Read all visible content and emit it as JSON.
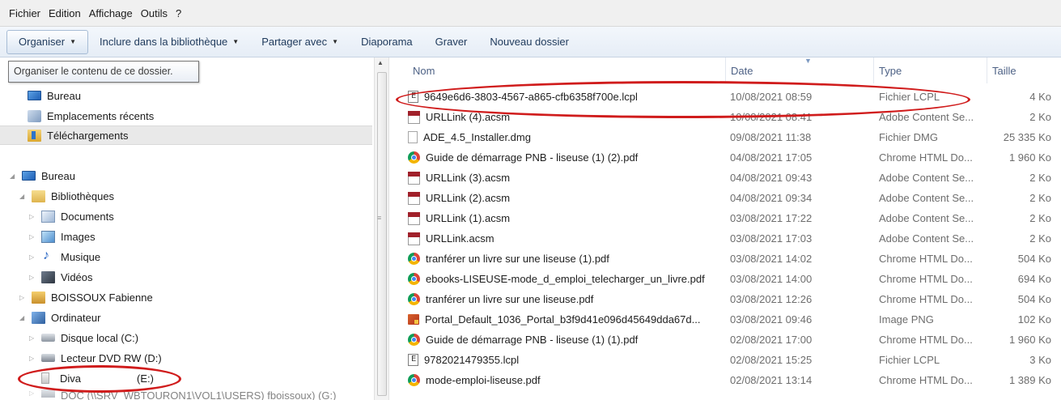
{
  "menu": [
    "Fichier",
    "Edition",
    "Affichage",
    "Outils",
    "?"
  ],
  "toolbar": {
    "organise_label": "Organiser",
    "include_label": "Inclure dans la bibliothèque",
    "share_label": "Partager avec",
    "slideshow_label": "Diaporama",
    "burn_label": "Graver",
    "new_folder_label": "Nouveau dossier"
  },
  "tooltip": "Organiser le contenu de ce dossier.",
  "nav": {
    "favorites": [
      {
        "label": "Bureau",
        "icon": "desktop-icon"
      },
      {
        "label": "Emplacements récents",
        "icon": "recent-places-icon"
      },
      {
        "label": "Téléchargements",
        "icon": "downloads-icon"
      }
    ],
    "tree": [
      {
        "label": "Bureau",
        "icon": "desktop-icon"
      },
      {
        "label": "Bibliothèques",
        "icon": "libraries-icon"
      },
      {
        "label": "Documents",
        "icon": "documents-icon"
      },
      {
        "label": "Images",
        "icon": "pictures-icon"
      },
      {
        "label": "Musique",
        "icon": "music-icon"
      },
      {
        "label": "Vidéos",
        "icon": "videos-icon"
      },
      {
        "label": "BOISSOUX Fabienne",
        "icon": "user-folder-icon"
      },
      {
        "label": "Ordinateur",
        "icon": "computer-icon"
      },
      {
        "label": "Disque local (C:)",
        "icon": "local-disk-icon"
      },
      {
        "label": "Lecteur DVD RW (D:)",
        "icon": "dvd-drive-icon"
      },
      {
        "label": "Diva",
        "drive": "(E:)",
        "icon": "usb-drive-icon"
      },
      {
        "label": "DOC (\\\\SRV_WBTOURON1\\VOL1\\USERS) fboissoux) (G:)",
        "icon": "network-drive-icon"
      }
    ]
  },
  "columns": {
    "name": "Nom",
    "date": "Date",
    "type": "Type",
    "size": "Taille"
  },
  "files": [
    {
      "name": "9649e6d6-3803-4567-a865-cfb6358f700e.lcpl",
      "date": "10/08/2021 08:59",
      "type": "Fichier LCPL",
      "size": "4 Ko",
      "icon": "lcpl"
    },
    {
      "name": "URLLink (4).acsm",
      "date": "10/08/2021 08:41",
      "type": "Adobe Content Se...",
      "size": "2 Ko",
      "icon": "acsm"
    },
    {
      "name": "ADE_4.5_Installer.dmg",
      "date": "09/08/2021 11:38",
      "type": "Fichier DMG",
      "size": "25 335 Ko",
      "icon": "dmg"
    },
    {
      "name": "Guide de démarrage PNB - liseuse (1) (2).pdf",
      "date": "04/08/2021 17:05",
      "type": "Chrome HTML Do...",
      "size": "1 960 Ko",
      "icon": "chrome"
    },
    {
      "name": "URLLink (3).acsm",
      "date": "04/08/2021 09:43",
      "type": "Adobe Content Se...",
      "size": "2 Ko",
      "icon": "acsm"
    },
    {
      "name": "URLLink (2).acsm",
      "date": "04/08/2021 09:34",
      "type": "Adobe Content Se...",
      "size": "2 Ko",
      "icon": "acsm"
    },
    {
      "name": "URLLink (1).acsm",
      "date": "03/08/2021 17:22",
      "type": "Adobe Content Se...",
      "size": "2 Ko",
      "icon": "acsm"
    },
    {
      "name": "URLLink.acsm",
      "date": "03/08/2021 17:03",
      "type": "Adobe Content Se...",
      "size": "2 Ko",
      "icon": "acsm"
    },
    {
      "name": "tranférer un livre sur une liseuse (1).pdf",
      "date": "03/08/2021 14:02",
      "type": "Chrome HTML Do...",
      "size": "504 Ko",
      "icon": "chrome"
    },
    {
      "name": "ebooks-LISEUSE-mode_d_emploi_telecharger_un_livre.pdf",
      "date": "03/08/2021 14:00",
      "type": "Chrome HTML Do...",
      "size": "694 Ko",
      "icon": "chrome"
    },
    {
      "name": "tranférer un livre sur une liseuse.pdf",
      "date": "03/08/2021 12:26",
      "type": "Chrome HTML Do...",
      "size": "504 Ko",
      "icon": "chrome"
    },
    {
      "name": "Portal_Default_1036_Portal_b3f9d41e096d45649dda67d...",
      "date": "03/08/2021 09:46",
      "type": "Image PNG",
      "size": "102 Ko",
      "icon": "png"
    },
    {
      "name": "Guide de démarrage PNB - liseuse (1) (1).pdf",
      "date": "02/08/2021 17:00",
      "type": "Chrome HTML Do...",
      "size": "1 960 Ko",
      "icon": "chrome"
    },
    {
      "name": "9782021479355.lcpl",
      "date": "02/08/2021 15:25",
      "type": "Fichier LCPL",
      "size": "3 Ko",
      "icon": "lcpl"
    },
    {
      "name": "mode-emploi-liseuse.pdf",
      "date": "02/08/2021 13:14",
      "type": "Chrome HTML Do...",
      "size": "1 389 Ko",
      "icon": "chrome"
    }
  ],
  "colors": {
    "annotation": "#d01c1c",
    "header_text": "#4d6185",
    "selected_bg": "#e9e9e9"
  }
}
